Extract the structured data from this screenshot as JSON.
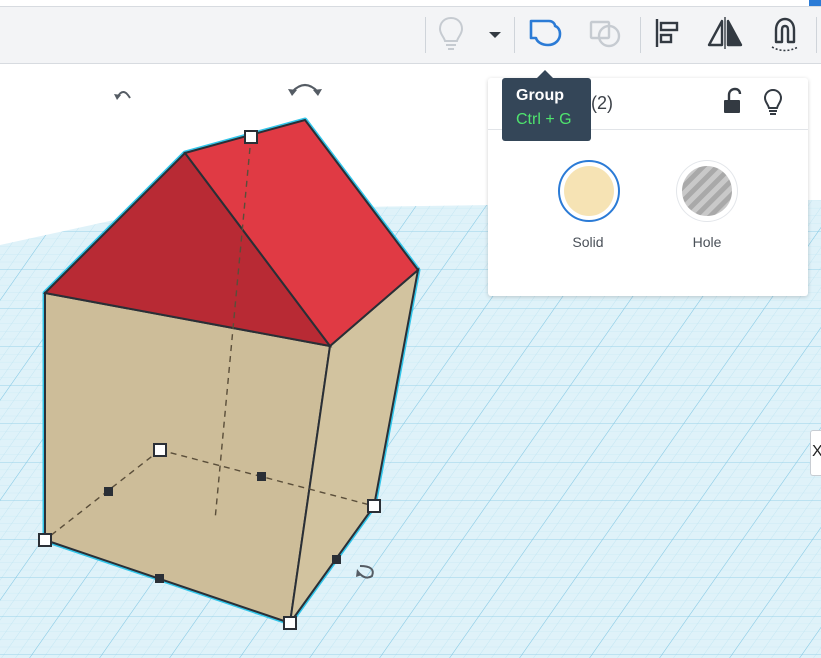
{
  "toolbar": {
    "buttons": [
      {
        "name": "show-hide-light-bulb",
        "icon": "light-bulb-icon"
      },
      {
        "name": "visibility-dropdown",
        "icon": "chevron-down-icon"
      },
      {
        "name": "group",
        "icon": "group-icon"
      },
      {
        "name": "ungroup",
        "icon": "ungroup-icon"
      },
      {
        "name": "align",
        "icon": "align-icon"
      },
      {
        "name": "mirror",
        "icon": "mirror-icon"
      },
      {
        "name": "cruise",
        "icon": "magnet-icon"
      }
    ]
  },
  "tooltip": {
    "title": "Group",
    "shortcut": "Ctrl + G"
  },
  "inspector": {
    "title": "apes(2)",
    "lock_icon": "unlock-icon",
    "bulb_icon": "light-bulb-icon",
    "solid_label": "Solid",
    "hole_label": "Hole",
    "solid_color": "#f6e3b4",
    "hole_color": "#a9a9a9"
  },
  "scene": {
    "rotate_left_icon": "rotate-arrow-icon",
    "rotate_top_icon": "rotate-arrow-icon",
    "rotate_bottom_icon": "rotate-arrow-icon",
    "roof_color": "#e03a44",
    "wall_color": "#cdbd99",
    "selection_color": "#33c6ea",
    "grid_color": "#a9dcee"
  },
  "edge_tab": {
    "label": "X"
  }
}
